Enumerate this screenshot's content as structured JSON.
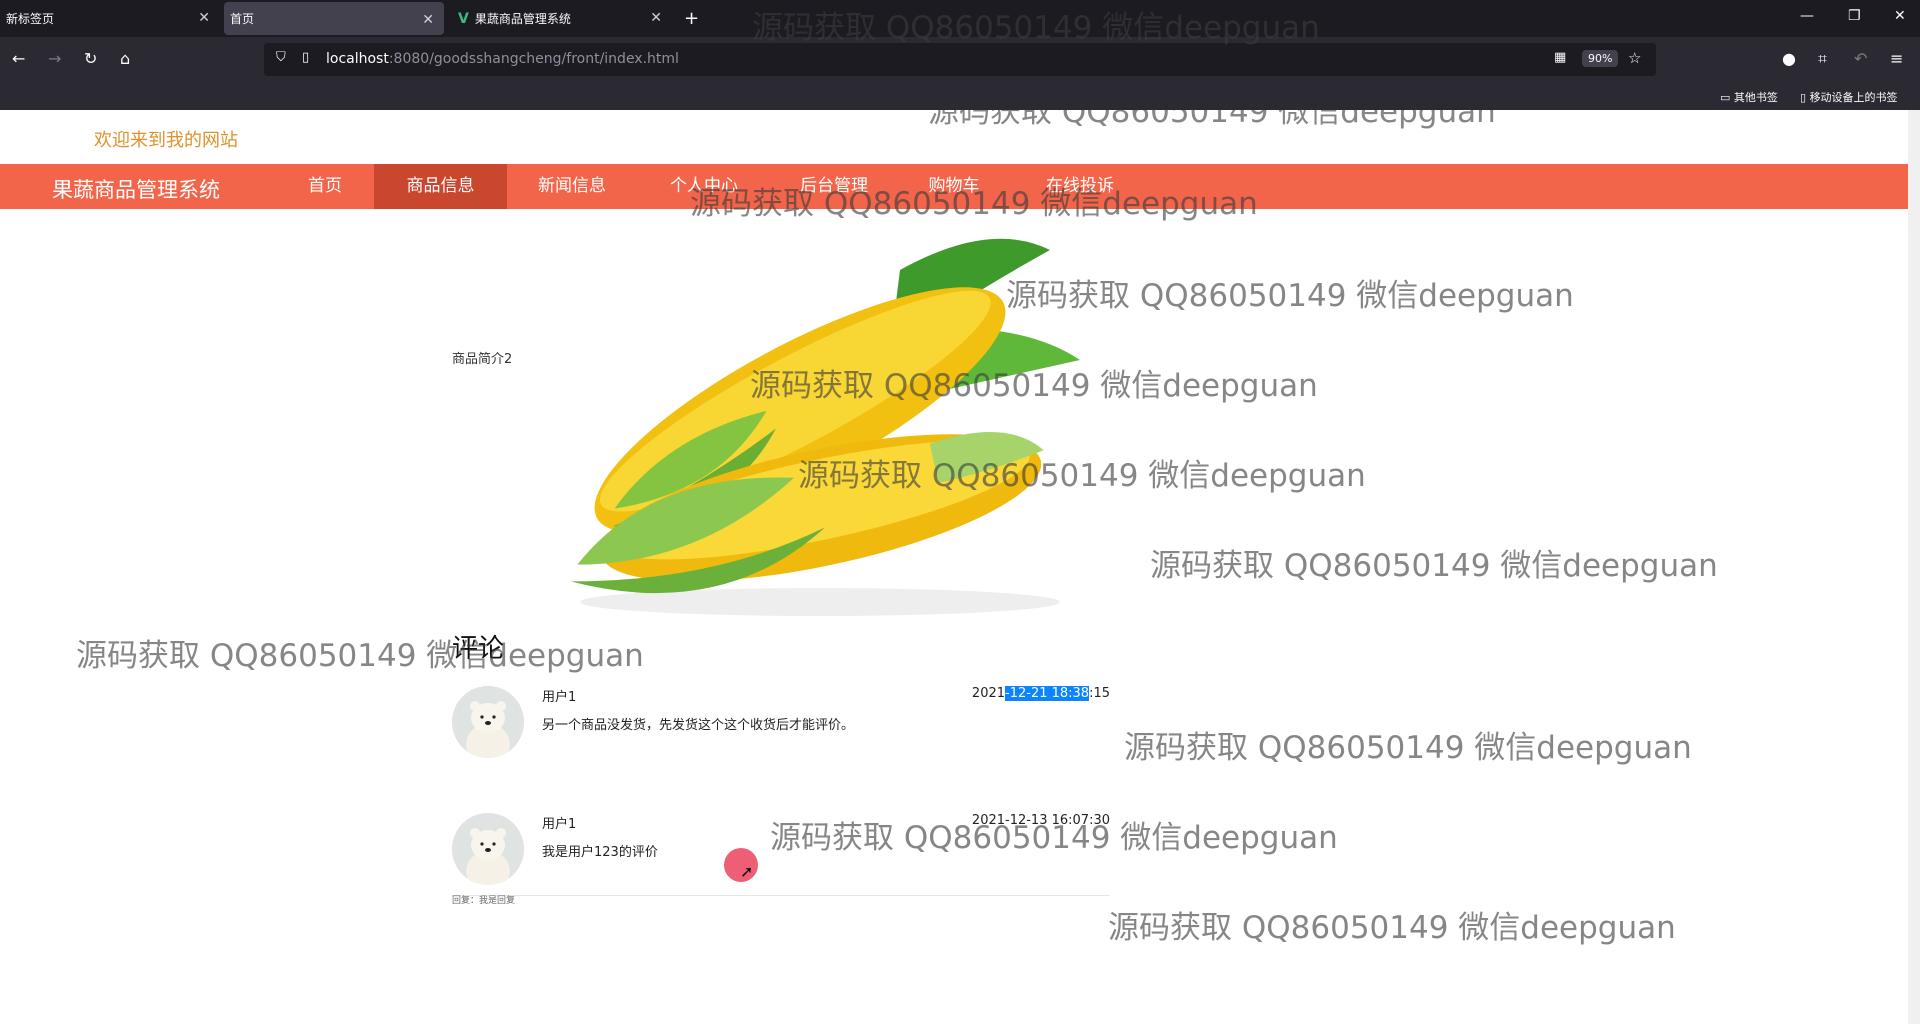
{
  "browser": {
    "tabs": [
      {
        "label": "新标签页"
      },
      {
        "label": "首页"
      },
      {
        "label": "果蔬商品管理系统"
      }
    ],
    "url": {
      "host": "localhost",
      "path": ":8080/goodsshangcheng/front/index.html"
    },
    "zoom": "90%",
    "bookmarks": [
      "其他书签",
      "移动设备上的书签"
    ]
  },
  "site": {
    "welcome": "欢迎来到我的网站",
    "brand": "果蔬商品管理系统",
    "nav": [
      "首页",
      "商品信息",
      "新闻信息",
      "个人中心",
      "后台管理",
      "购物车",
      "在线投诉"
    ],
    "active_nav": "商品信息"
  },
  "product": {
    "intro": "商品简介2",
    "image": "corn-image"
  },
  "comments": {
    "title": "评论",
    "items": [
      {
        "user": "用户1",
        "text": "另一个商品没发货，先发货这个这个收货后才能评价。",
        "time_prefix": "2021",
        "time_selected": "-12-21 18:38",
        "time_suffix": ":15",
        "reply": ""
      },
      {
        "user": "用户1",
        "text": "我是用户123的评价",
        "time": "2021-12-13 16:07:30",
        "reply": "回复：我是回复"
      }
    ]
  },
  "watermark": "源码获取 QQ86050149 微信deepguan",
  "colors": {
    "nav_bg": "#f3654a",
    "nav_active": "#c9462f",
    "welcome": "#e0912b",
    "selection": "#0a84ff"
  }
}
